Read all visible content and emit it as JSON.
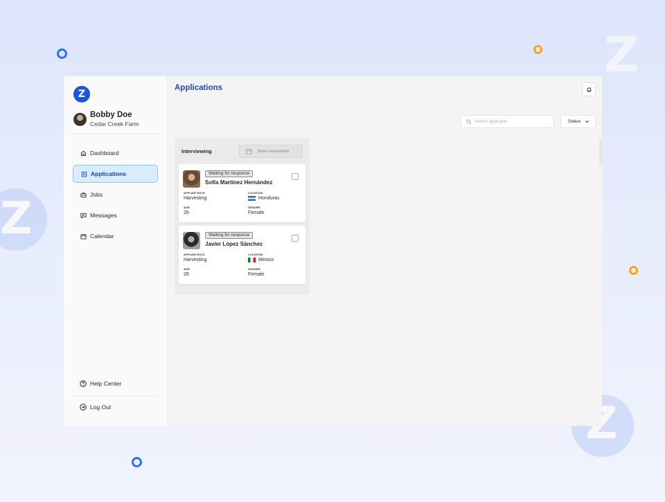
{
  "brand": {
    "logo_letter": "Z",
    "accent": "#1a4cb8",
    "logo_color": "#1a56db",
    "active_bg": "#d8ecfb"
  },
  "user": {
    "name": "Bobby Doe",
    "farm": "Cedar Creek Farm"
  },
  "sidebar": {
    "items": [
      {
        "label": "Dashboard",
        "icon": "home-icon"
      },
      {
        "label": "Applications",
        "icon": "clipboard-icon",
        "active": true
      },
      {
        "label": "Jobs",
        "icon": "briefcase-icon"
      },
      {
        "label": "Messages",
        "icon": "message-icon"
      },
      {
        "label": "Calendar",
        "icon": "calendar-icon"
      }
    ],
    "help": {
      "label": "Help Center",
      "icon": "help-circle-icon"
    },
    "logout": {
      "label": "Log Out",
      "icon": "logout-icon"
    }
  },
  "main": {
    "title": "Applications",
    "notification_icon": "bell-icon",
    "search": {
      "placeholder": "Search applicants",
      "value": ""
    },
    "status_filter": {
      "label": "Status",
      "icon": "chevron-down-icon"
    }
  },
  "board": {
    "column": {
      "title": "Interviewing",
      "share_label": "Share Availability",
      "share_icon": "calendar-icon"
    },
    "labels": {
      "role": "APPLIED ROLE",
      "location": "LOCATION",
      "age": "AGE",
      "gender": "GENDER"
    },
    "cards": [
      {
        "status": "Waiting for response",
        "name": "Sofía Martínez Hernández",
        "role": "Harvesting",
        "location": "Honduras",
        "flag": "honduras-flag",
        "age": "26",
        "gender": "Female"
      },
      {
        "status": "Waiting for response",
        "name": "Javier López Sánchez",
        "role": "Harvesting",
        "location": "Mexico",
        "flag": "mexico-flag",
        "age": "26",
        "gender": "Female"
      }
    ]
  }
}
